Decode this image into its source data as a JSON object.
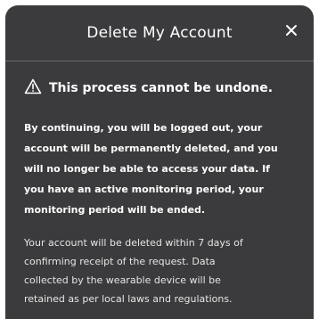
{
  "modal": {
    "title": "Delete My Account",
    "close_icon": "close-icon",
    "warning": {
      "icon": "warning-triangle-icon",
      "text": "This process cannot be undone."
    },
    "bold_lines": [
      "By continuing, you will be logged out, your",
      "account will be permanently deleted, and you",
      "will no longer be able to access your data. If",
      "you have an active monitoring period, your",
      "monitoring period will be ended."
    ],
    "regular_lines": [
      "Your account will be deleted within 7 days of",
      "confirming receipt of the request. Data",
      "collected by the wearable device will be",
      "retained as per local laws and regulations."
    ]
  },
  "colors": {
    "modal_background": "#3b3b3d",
    "text": "#ffffff"
  }
}
